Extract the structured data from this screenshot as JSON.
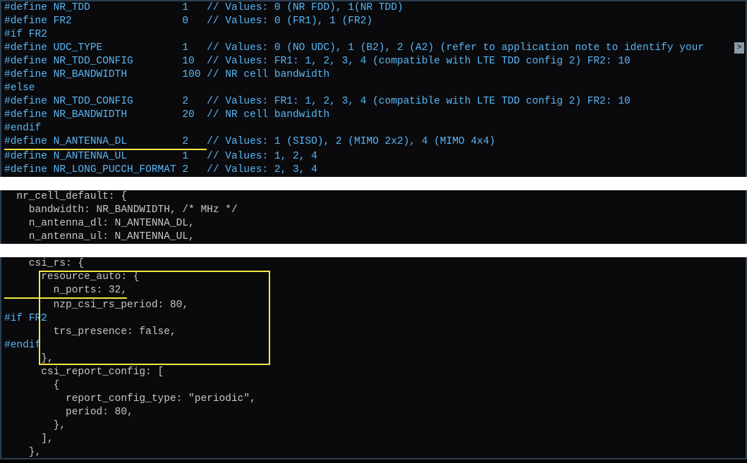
{
  "colors": {
    "keyword": "#59b7f5",
    "highlight": "#f4e842"
  },
  "block1": {
    "lines": [
      {
        "pre": "#define NR_TDD               1   ",
        "c": "// Values: 0 (NR FDD), 1(NR TDD)"
      },
      {
        "pre": "#define FR2                  0   ",
        "c": "// Values: 0 (FR1), 1 (FR2)"
      },
      {
        "pre": "#if FR2",
        "c": ""
      },
      {
        "pre": "#define UDC_TYPE             1   ",
        "c": "// Values: 0 (NO UDC), 1 (B2), 2 (A2) (refer to application note to identify your "
      },
      {
        "pre": "#define NR_TDD_CONFIG        10  ",
        "c": "// Values: FR1: 1, 2, 3, 4 (compatible with LTE TDD config 2) FR2: 10"
      },
      {
        "pre": "#define NR_BANDWIDTH         100 ",
        "c": "// NR cell bandwidth"
      },
      {
        "pre": "#else",
        "c": ""
      },
      {
        "pre": "#define NR_TDD_CONFIG        2   ",
        "c": "// Values: FR1: 1, 2, 3, 4 (compatible with LTE TDD config 2) FR2: 10"
      },
      {
        "pre": "#define NR_BANDWIDTH         20  ",
        "c": "// NR cell bandwidth"
      },
      {
        "pre": "#endif",
        "c": ""
      },
      {
        "pre": "#define N_ANTENNA_DL         2   ",
        "c": "// Values: 1 (SISO), 2 (MIMO 2x2), 4 (MIMO 4x4)",
        "ul": true
      },
      {
        "pre": "#define N_ANTENNA_UL         1   ",
        "c": "// Values: 1, 2, 4"
      },
      {
        "pre": "#define NR_LONG_PUCCH_FORMAT 2   ",
        "c": "// Values: 2, 3, 4"
      }
    ]
  },
  "block2": {
    "raw": "  nr_cell_default: {\n    bandwidth: NR_BANDWIDTH, /* MHz */\n    n_antenna_dl: N_ANTENNA_DL,\n    n_antenna_ul: N_ANTENNA_UL,"
  },
  "block3": {
    "l1": "    csi_rs: {",
    "l2": "      resource_auto: {",
    "l3": "        n_ports: 32,",
    "l4": "        nzp_csi_rs_period: 80,",
    "l5": "#if FR2",
    "l6": "        trs_presence: false,",
    "l7": "#endif",
    "l8": "      },",
    "l9": "      csi_report_config: [\n        {\n          report_config_type: \"periodic\",\n          period: 80,\n        },\n      ],\n    },"
  },
  "scroll_glyph": ">"
}
